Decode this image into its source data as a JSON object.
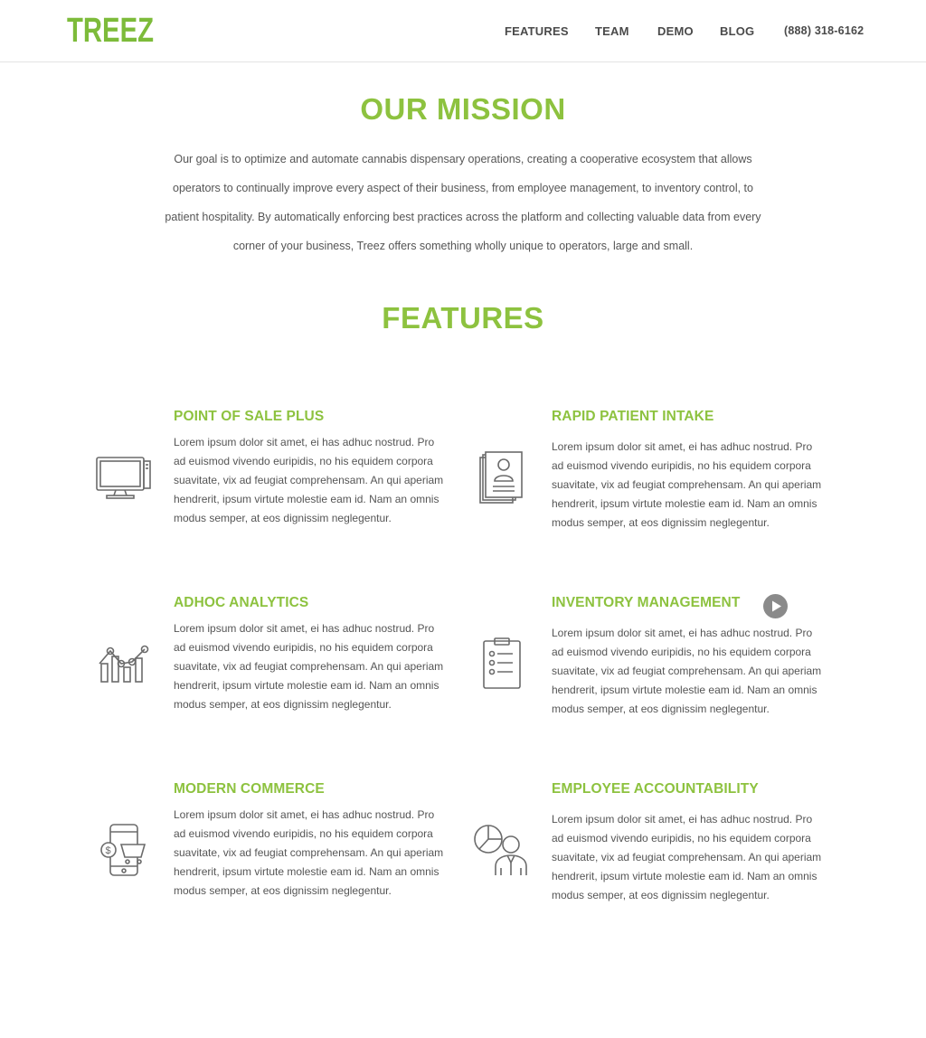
{
  "header": {
    "logo_text": "TREEZ",
    "nav": [
      {
        "label": "FEATURES"
      },
      {
        "label": "TEAM"
      },
      {
        "label": "DEMO"
      },
      {
        "label": "BLOG"
      },
      {
        "label": "(888) 318-6162"
      }
    ]
  },
  "mission": {
    "title": "OUR MISSION",
    "text": "Our goal is to optimize and automate cannabis dispensary operations, creating a cooperative ecosystem that allows operators to continually improve every aspect of their business, from employee management, to inventory control, to patient hospitality. By automatically enforcing best practices across the platform and collecting valuable data from every corner of your business, Treez offers something wholly unique to operators, large and small."
  },
  "features": {
    "title": "FEATURES",
    "items": [
      {
        "title": "POINT OF SALE PLUS",
        "icon": "monitor-icon",
        "text": "Lorem ipsum dolor sit amet, ei has adhuc nostrud. Pro ad euismod vivendo euripidis, no his equidem corpora suavitate, vix ad feugiat comprehensam. An qui aperiam hendrerit, ipsum virtute molestie eam id. Nam an omnis modus semper, at eos dignissim neglegentur."
      },
      {
        "title": "RAPID PATIENT INTAKE",
        "icon": "patient-files-icon",
        "text": "Lorem ipsum dolor sit amet, ei has adhuc nostrud. Pro ad euismod vivendo euripidis, no his equidem corpora suavitate, vix ad feugiat comprehensam. An qui aperiam hendrerit, ipsum virtute molestie eam id. Nam an omnis modus semper, at eos dignissim neglegentur."
      },
      {
        "title": "ADHOC ANALYTICS",
        "icon": "analytics-chart-icon",
        "text": "Lorem ipsum dolor sit amet, ei has adhuc nostrud. Pro ad euismod vivendo euripidis, no his equidem corpora suavitate, vix ad feugiat comprehensam. An qui aperiam hendrerit, ipsum virtute molestie eam id. Nam an omnis modus semper, at eos dignissim neglegentur."
      },
      {
        "title": "INVENTORY MANAGEMENT",
        "icon": "clipboard-checklist-icon",
        "text": "Lorem ipsum dolor sit amet, ei has adhuc nostrud. Pro ad euismod vivendo euripidis, no his equidem corpora suavitate, vix ad feugiat comprehensam. An qui aperiam hendrerit, ipsum virtute molestie eam id. Nam an omnis modus semper, at eos dignissim neglegentur."
      },
      {
        "title": "MODERN COMMERCE",
        "icon": "mobile-commerce-icon",
        "text": "Lorem ipsum dolor sit amet, ei has adhuc nostrud. Pro ad euismod vivendo euripidis, no his equidem corpora suavitate, vix ad feugiat comprehensam. An qui aperiam hendrerit, ipsum virtute molestie eam id. Nam an omnis modus semper, at eos dignissim neglegentur."
      },
      {
        "title": "EMPLOYEE ACCOUNTABILITY",
        "icon": "employee-pie-chart-icon",
        "text": "Lorem ipsum dolor sit amet, ei has adhuc nostrud. Pro ad euismod vivendo euripidis, no his equidem corpora suavitate, vix ad feugiat comprehensam. An qui aperiam hendrerit, ipsum virtute molestie eam id. Nam an omnis modus semper, at eos dignissim neglegentur."
      }
    ]
  },
  "controls": {
    "play_icon": "play-icon"
  },
  "colors": {
    "accent": "#8dc23f",
    "text": "#555555",
    "nav_text": "#4a4a4a",
    "icon_stroke": "#6b6b6b",
    "play_button": "#8a8a8a"
  }
}
